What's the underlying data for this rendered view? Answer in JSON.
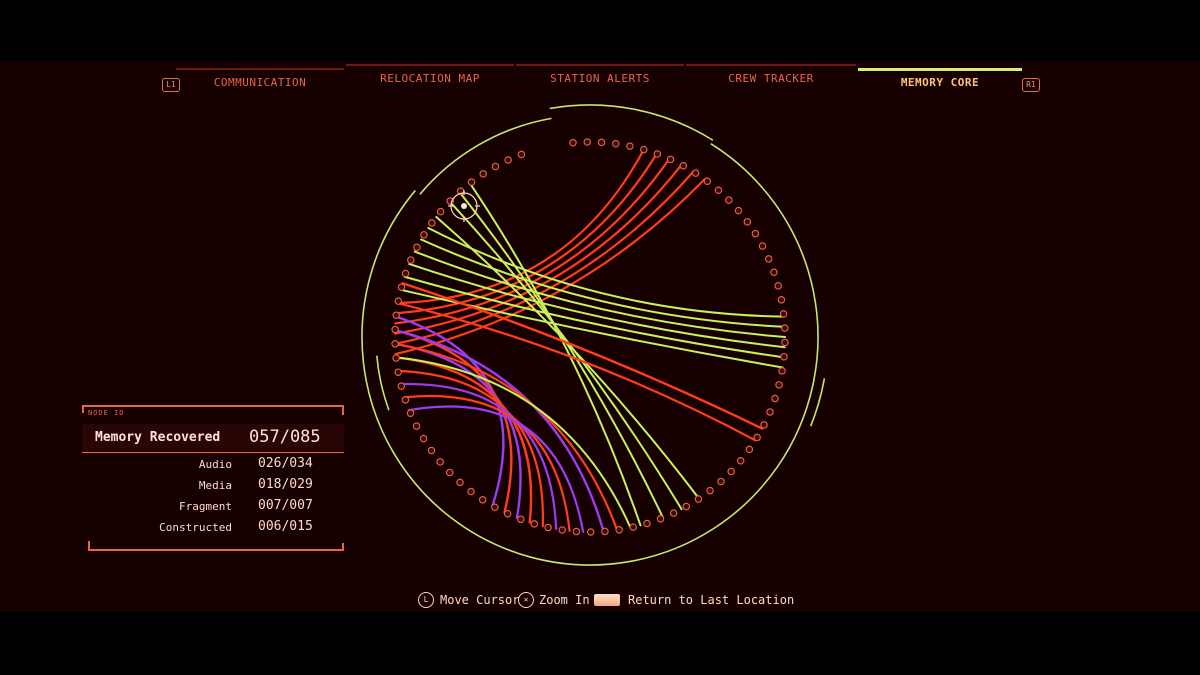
{
  "nav": {
    "left_bumper": "L1",
    "right_bumper": "R1",
    "tabs": [
      {
        "label": "COMMUNICATION",
        "active": false
      },
      {
        "label": "RELOCATION MAP",
        "active": false
      },
      {
        "label": "STATION ALERTS",
        "active": false
      },
      {
        "label": "CREW TRACKER",
        "active": false
      },
      {
        "label": "MEMORY CORE",
        "active": true
      }
    ]
  },
  "stats": {
    "header": "NODE ID",
    "main_label": "Memory Recovered",
    "main_value": "057/085",
    "rows": [
      {
        "label": "Audio",
        "value": "026/034"
      },
      {
        "label": "Media",
        "value": "018/029"
      },
      {
        "label": "Fragment",
        "value": "007/007"
      },
      {
        "label": "Constructed",
        "value": "006/015"
      }
    ]
  },
  "hints": {
    "move_icon": "L",
    "move_label": "Move Cursor",
    "zoom_icon": "✕",
    "zoom_label": "Zoom In",
    "return_label": "Return to Last Location"
  },
  "colors": {
    "background": "#170000",
    "ring": "#c8e86a",
    "accent": "#e8654a",
    "active_tab": "#ffc27a",
    "audio_link": "#ff3d1a",
    "media_link": "#c8f25a",
    "constructed_link": "#9a3cf0"
  }
}
